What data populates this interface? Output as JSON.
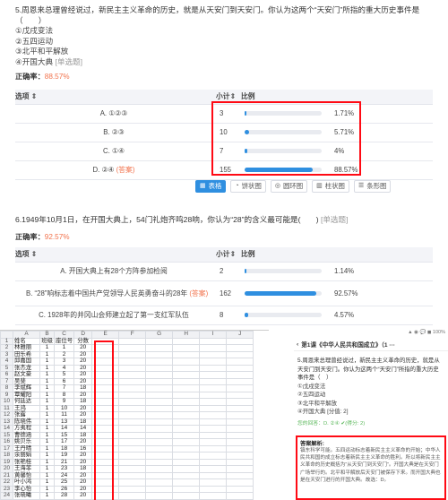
{
  "q5": {
    "text": "5.周恩来总理曾经说过，新民主主义革命的历史，就是从天安门到天安门。你认为这两个“天安门”所指的重大历史事件是（　　）",
    "options": [
      "①戊戌变法",
      "②五四运动",
      "③北平和平解放",
      "④开国大典"
    ],
    "type_hint": "[单选题]",
    "accuracy_label": "正确率：",
    "accuracy": "88.57%",
    "table_headers": {
      "option": "选项 ⇕",
      "count": "小计⇕",
      "ratio": "比例"
    },
    "rows": [
      {
        "option": "A. ①②③",
        "tag": "",
        "count": "3",
        "pct": "1.71%",
        "fraction": 0.0171
      },
      {
        "option": "B. ②③",
        "tag": "",
        "count": "10",
        "pct": "5.71%",
        "fraction": 0.0571
      },
      {
        "option": "C. ①④",
        "tag": "",
        "count": "7",
        "pct": "4%",
        "fraction": 0.04
      },
      {
        "option": "D. ②④",
        "tag": "(答案)",
        "count": "155",
        "pct": "88.57%",
        "fraction": 0.8857
      }
    ],
    "view_tabs": [
      {
        "label": "表格",
        "icon": "table-icon",
        "active": true
      },
      {
        "label": "饼状图",
        "icon": "pie-chart-icon",
        "active": false
      },
      {
        "label": "圆环图",
        "icon": "ring-chart-icon",
        "active": false
      },
      {
        "label": "柱状图",
        "icon": "bar-chart-icon",
        "active": false
      },
      {
        "label": "条形图",
        "icon": "hbar-chart-icon",
        "active": false
      }
    ]
  },
  "q6": {
    "text": "6.1949年10月1日，在开国大典上，54门礼炮齐鸣28响，你认为“28”的含义最可能是(　　)",
    "type_hint": "[单选题]",
    "accuracy_label": "正确率：",
    "accuracy": "92.57%",
    "table_headers": {
      "option": "选项 ⇕",
      "count": "小计⇕",
      "ratio": "比例"
    },
    "rows": [
      {
        "option": "A. 开国大典上有28个方阵参加检阅",
        "tag": "",
        "count": "2",
        "pct": "1.14%",
        "fraction": 0.0114
      },
      {
        "option": "B. “28”响标志着中国共产党领导人民英勇奋斗的28年",
        "tag": "(答案)",
        "count": "162",
        "pct": "92.57%",
        "fraction": 0.9257
      },
      {
        "option": "C. 1928年的井冈山会师建立起了第一支红军队伍",
        "tag": "",
        "count": "8",
        "pct": "4.57%",
        "fraction": 0.0457
      }
    ]
  },
  "sheet": {
    "columns": [
      "",
      "A",
      "B",
      "C",
      "D",
      "E",
      "F",
      "G",
      "H",
      "I",
      "J"
    ],
    "header_row": [
      "姓名",
      "班级",
      "座位号",
      "分数"
    ],
    "rows": [
      [
        "林雅丽",
        "1",
        "1",
        "20"
      ],
      [
        "田乐希",
        "1",
        "2",
        "20"
      ],
      [
        "邱嘉国",
        "1",
        "3",
        "20"
      ],
      [
        "张杰龙",
        "1",
        "4",
        "20"
      ],
      [
        "赵文豪",
        "1",
        "5",
        "20"
      ],
      [
        "吴斐",
        "1",
        "6",
        "20"
      ],
      [
        "李斌辉",
        "1",
        "7",
        "18"
      ],
      [
        "覃耀阳",
        "1",
        "8",
        "20"
      ],
      [
        "何廷达",
        "1",
        "9",
        "18"
      ],
      [
        "王鸿",
        "1",
        "10",
        "20"
      ],
      [
        "张露",
        "1",
        "11",
        "20"
      ],
      [
        "陈晓伟",
        "1",
        "13",
        "18"
      ],
      [
        "方夷程",
        "1",
        "14",
        "14"
      ],
      [
        "曹德涵",
        "1",
        "15",
        "18"
      ],
      [
        "姚贝乐",
        "1",
        "17",
        "20"
      ],
      [
        "王丹晴",
        "1",
        "18",
        "16"
      ],
      [
        "余丽娟",
        "1",
        "19",
        "20"
      ],
      [
        "张艳桂",
        "1",
        "21",
        "20"
      ],
      [
        "王海菲",
        "1",
        "23",
        "18"
      ],
      [
        "黄馨怡",
        "1",
        "24",
        "20"
      ],
      [
        "叶小鸿",
        "1",
        "25",
        "20"
      ],
      [
        "李心怡",
        "1",
        "26",
        "20"
      ],
      [
        "张晓曦",
        "1",
        "28",
        "20"
      ]
    ]
  },
  "phone": {
    "status_left": "",
    "status_right": "▲ ◉ 💬 ◼ 100%",
    "lesson_title": "第1课《中华人民共和国成立》（1 ···",
    "question": "5.周恩来总理曾经说过，新民主主义革命的历史，就是从天安门到天安门。你认为这两个“天安门”所指的重大历史事件是（　）",
    "options": [
      "①戊戌变法",
      "②五四运动",
      "③北平和平解放",
      "④开国大典  [分值: 2]"
    ],
    "my_answer": "您的回答：D. ②④  ✔(得分: 2)",
    "analysis_title": "答案解析:",
    "analysis": "镇东科学可能。五四运动标志着新民主主义革命的开始；中华人民共和国的成立标志着新民主主义革命的胜利。所以将新民主主义革命的历史概括为“从天安门到天安门”。开国大典是在天安门广场举行的。北平和平解放后天安门被保存下来。而开国大典也是在天安门进行的开国大典。故选：D。"
  }
}
